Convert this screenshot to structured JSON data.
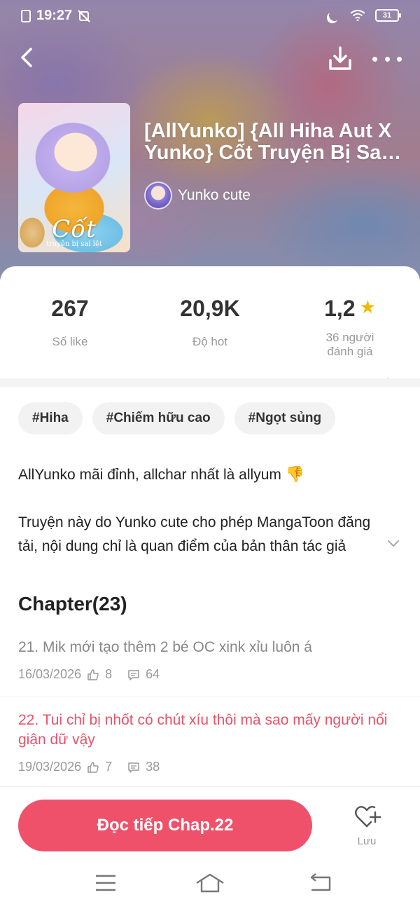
{
  "status_bar": {
    "time": "19:27",
    "battery": "31"
  },
  "book": {
    "title": "[AllYunko] {All Hiha Aut X Yunko} Cốt Truyện Bị Sai Lệch",
    "author": "Yunko cute",
    "cover_title": "Cốt",
    "cover_subtitle": "truyện bị sai lệt"
  },
  "stats": {
    "likes_value": "267",
    "likes_label": "Số like",
    "hot_value": "20,9K",
    "hot_label": "Độ hot",
    "rating_value": "1,2",
    "rating_label_line1": "36 người",
    "rating_label_line2": "đánh giá"
  },
  "tags": [
    "#Hiha",
    "#Chiếm hữu cao",
    "#Ngọt sủng"
  ],
  "description": {
    "line1": "AllYunko mãi đỉnh, allchar nhất là allyum",
    "paragraph2": "Truyện này do Yunko cute cho phép MangaToon đăng tải, nội dung chỉ là quan điểm của bản thân tác giả"
  },
  "chapters": {
    "heading": "Chapter(23)",
    "items": [
      {
        "name": "21. Mik mới tạo thêm 2 bé OC xink xỉu luôn á",
        "date": "16/03/2026",
        "likes": "8",
        "comments": "64",
        "current": false
      },
      {
        "name": "22. Tui chỉ bị nhốt có chút xíu thôi mà sao mấy người nổi giận dữ vậy",
        "date": "19/03/2026",
        "likes": "7",
        "comments": "38",
        "current": true
      }
    ]
  },
  "actions": {
    "continue_label": "Đọc tiếp Chap.22",
    "save_label": "Lưu"
  },
  "colors": {
    "accent": "#f0516a",
    "current_chapter": "#e8536a",
    "star": "#f5b800"
  },
  "icons": [
    "back-icon",
    "download-icon",
    "more-icon",
    "star-icon",
    "chevron-right-icon",
    "chevron-down-icon",
    "like-icon",
    "comment-icon",
    "heart-plus-icon",
    "menu-icon",
    "home-icon",
    "back-nav-icon"
  ]
}
